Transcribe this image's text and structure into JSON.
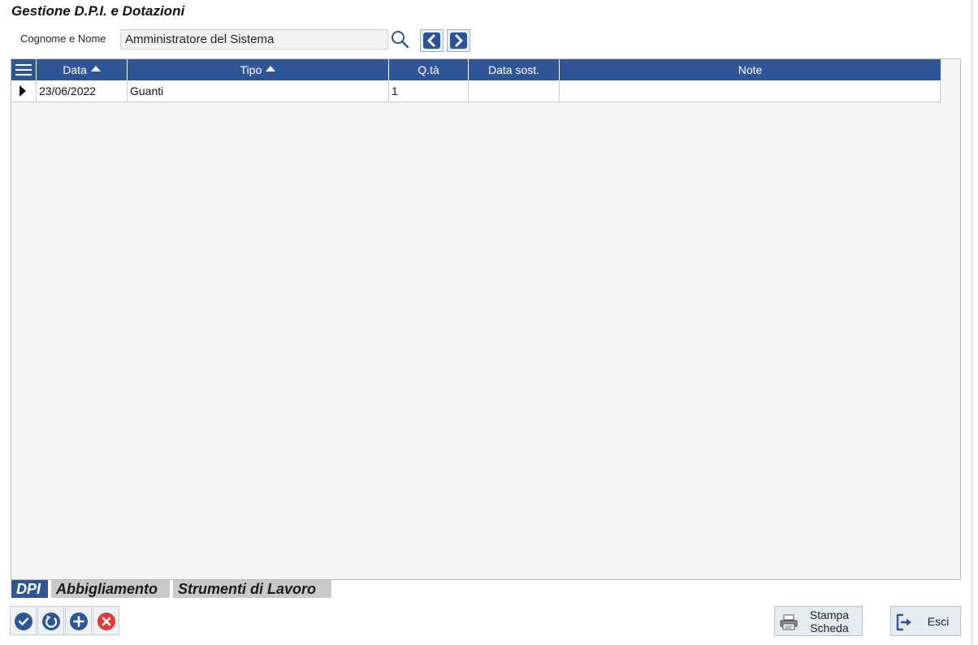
{
  "page": {
    "title": "Gestione D.P.I. e Dotazioni"
  },
  "search": {
    "label": "Cognome e Nome",
    "value": "Amministratore del Sistema"
  },
  "grid": {
    "columns": [
      {
        "label": "Data",
        "sort": "ascending"
      },
      {
        "label": "Tipo",
        "sort": "ascending"
      },
      {
        "label": "Q.tà"
      },
      {
        "label": "Data sost."
      },
      {
        "label": "Note"
      }
    ],
    "rows": [
      {
        "selected": true,
        "data": "23/06/2022",
        "tipo": "Guanti",
        "qta": "1",
        "data_sost": "",
        "note": ""
      }
    ]
  },
  "tabs": [
    {
      "label": "DPI",
      "active": true
    },
    {
      "label": "Abbigliamento",
      "active": false
    },
    {
      "label": "Strumenti di Lavoro",
      "active": false
    }
  ],
  "actions": [
    {
      "icon": "confirm-check-icon",
      "color": "#2e5597"
    },
    {
      "icon": "undo-refresh-icon",
      "color": "#2e5597"
    },
    {
      "icon": "add-plus-icon",
      "color": "#2e5597"
    },
    {
      "icon": "delete-x-icon",
      "color": "#e03a3a"
    }
  ],
  "buttons": {
    "print_label_line1": "Stampa",
    "print_label_line2": "Scheda",
    "exit_label": "Esci"
  },
  "colors": {
    "accent": "#2e5597",
    "delete": "#e03a3a"
  }
}
